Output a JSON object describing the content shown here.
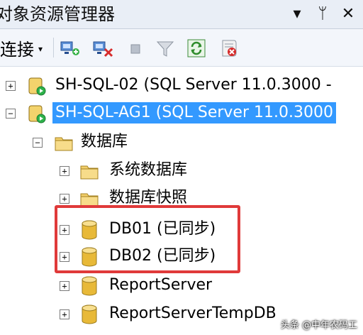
{
  "window": {
    "title": "对象资源管理器",
    "controls": [
      "▾",
      "ᛘ",
      "✕"
    ]
  },
  "toolbar": {
    "connect_label": "连接",
    "connect_caret": "▾"
  },
  "tree": {
    "servers": [
      {
        "label": "SH-SQL-02 (SQL Server 11.0.3000 -",
        "expander": "+"
      },
      {
        "label": "SH-SQL-AG1 (SQL Server 11.0.3000",
        "expander": "−"
      }
    ],
    "databases_folder": {
      "label": "数据库",
      "expander": "−"
    },
    "children": [
      {
        "label": "系统数据库",
        "expander": "+",
        "icon": "folder-icon"
      },
      {
        "label": "数据库快照",
        "expander": "+",
        "icon": "folder-icon"
      },
      {
        "label": "DB01 (已同步)",
        "expander": "+",
        "icon": "database-icon"
      },
      {
        "label": "DB02 (已同步)",
        "expander": "+",
        "icon": "database-icon"
      },
      {
        "label": "ReportServer",
        "expander": "+",
        "icon": "database-icon"
      },
      {
        "label": "ReportServerTempDB",
        "expander": "+",
        "icon": "database-icon"
      }
    ]
  },
  "watermark": "头条 @中年农码工",
  "colors": {
    "selection": "#3399ff",
    "highlight_box": "#e03a3a",
    "folder": "#f2cf6b",
    "database": "#e8b938"
  }
}
